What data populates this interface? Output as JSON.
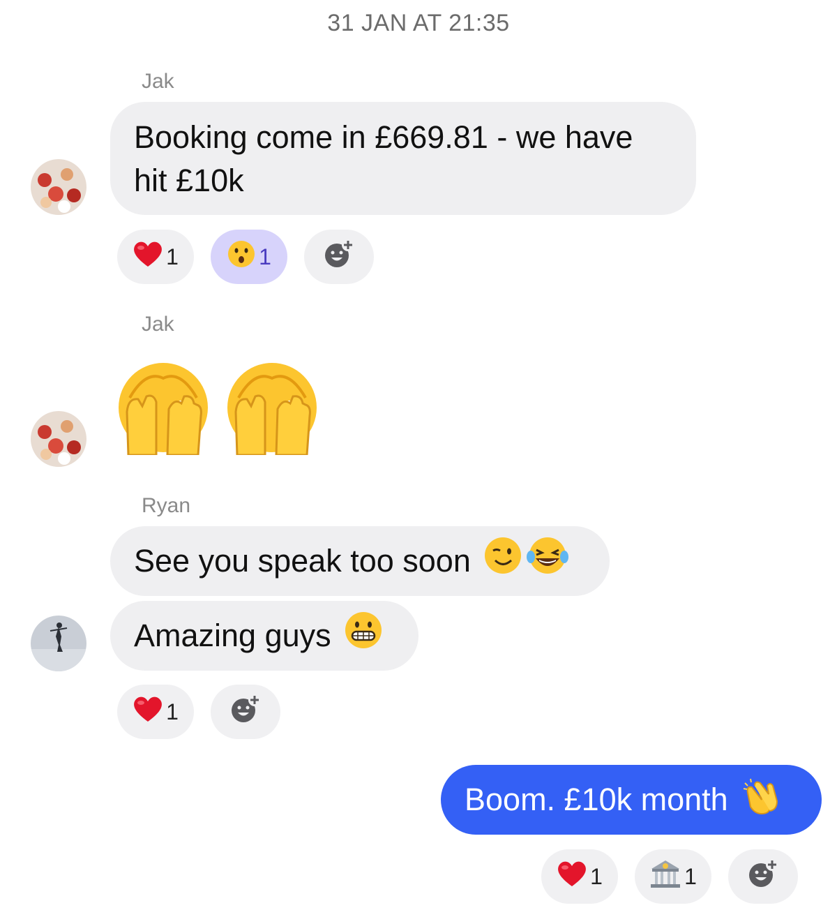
{
  "timestamp": "31 JAN AT 21:35",
  "messages": [
    {
      "sender": "Jak",
      "text_line1": "Booking come in £669.81 - we have",
      "text_line2": "hit £10k",
      "reactions": [
        {
          "icon": "heart-icon",
          "count": "1"
        },
        {
          "icon": "surprised-face-icon",
          "count": "1"
        }
      ]
    },
    {
      "sender": "Jak",
      "emojis": [
        "see-no-evil-face-icon",
        "see-no-evil-face-icon"
      ]
    },
    {
      "sender": "Ryan",
      "text1": "See you speak too soon",
      "text2": "Amazing guys",
      "reactions": [
        {
          "icon": "heart-icon",
          "count": "1"
        }
      ]
    },
    {
      "sender": "me",
      "text": "Boom. £10k month",
      "reactions": [
        {
          "icon": "heart-icon",
          "count": "1"
        },
        {
          "icon": "bank-icon",
          "count": "1"
        }
      ]
    }
  ],
  "colors": {
    "outgoing_bubble": "#3460f5",
    "incoming_bubble": "#efeff1",
    "active_reaction": "#d7d3fb"
  }
}
